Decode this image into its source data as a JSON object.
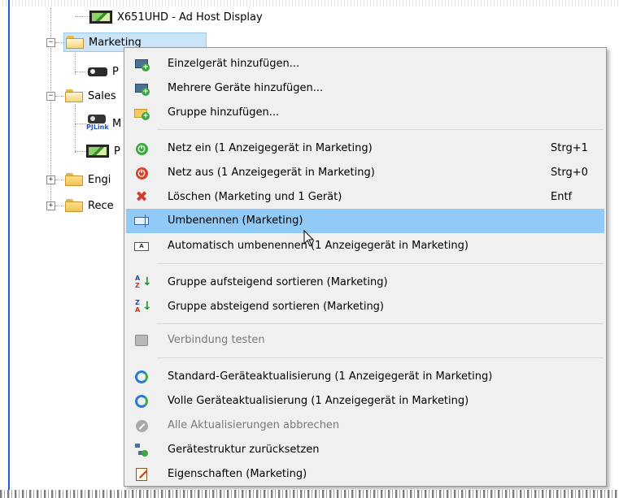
{
  "tree": {
    "items": [
      {
        "label": "X651UHD - Ad Host Display"
      },
      {
        "label": "Marketing"
      },
      {
        "label": "P"
      },
      {
        "label": "Sales"
      },
      {
        "label": "M",
        "sublabel": "PJLink"
      },
      {
        "label": "P"
      },
      {
        "label": "Engi"
      },
      {
        "label": "Rece"
      }
    ],
    "expander_minus": "−",
    "expander_plus": "+"
  },
  "context_menu": {
    "items": [
      {
        "label": "Einzelgerät hinzufügen...",
        "icon": "add-device-icon"
      },
      {
        "label": "Mehrere Geräte hinzufügen...",
        "icon": "add-multiple-devices-icon"
      },
      {
        "label": "Gruppe hinzufügen...",
        "icon": "add-group-icon"
      },
      {
        "label": "Netz ein  (1 Anzeigegerät in Marketing)",
        "shortcut": "Strg+1",
        "icon": "power-on-icon"
      },
      {
        "label": "Netz aus  (1 Anzeigegerät in Marketing)",
        "shortcut": "Strg+0",
        "icon": "power-off-icon"
      },
      {
        "label": "Löschen  (Marketing und 1 Gerät)",
        "shortcut": "Entf",
        "icon": "delete-icon"
      },
      {
        "label": "Umbenennen  (Marketing)",
        "icon": "rename-icon",
        "highlighted": true
      },
      {
        "label": "Automatisch umbenennen  (1 Anzeigegerät in Marketing)",
        "icon": "auto-rename-icon"
      },
      {
        "label": "Gruppe aufsteigend sortieren  (Marketing)",
        "icon": "sort-ascending-icon"
      },
      {
        "label": "Gruppe absteigend sortieren  (Marketing)",
        "icon": "sort-descending-icon"
      },
      {
        "label": "Verbindung testen",
        "icon": "test-connection-icon",
        "disabled": true
      },
      {
        "label": "Standard-Geräteaktualisierung  (1 Anzeigegerät in Marketing)",
        "icon": "standard-update-icon"
      },
      {
        "label": "Volle Geräteaktualisierung  (1 Anzeigegerät in Marketing)",
        "icon": "full-update-icon"
      },
      {
        "label": "Alle Aktualisierungen abbrechen",
        "icon": "cancel-updates-icon",
        "disabled": true
      },
      {
        "label": "Gerätestruktur zurücksetzen",
        "icon": "reset-structure-icon"
      },
      {
        "label": "Eigenschaften  (Marketing)",
        "icon": "properties-icon"
      }
    ]
  },
  "icon_glyphs": {
    "plus": "+",
    "power": "⏻",
    "delete": "✖",
    "autorename_text": "A",
    "sort_asc_top": "A",
    "sort_asc_bottom": "Z",
    "sort_desc_top": "Z",
    "sort_desc_bottom": "A",
    "arrow_down": "↓"
  },
  "colors": {
    "highlight": "#91c9f7",
    "selected_node": "#cce4f7",
    "menu_background": "#f0f0f0",
    "disabled_text": "#7a7a7a"
  }
}
